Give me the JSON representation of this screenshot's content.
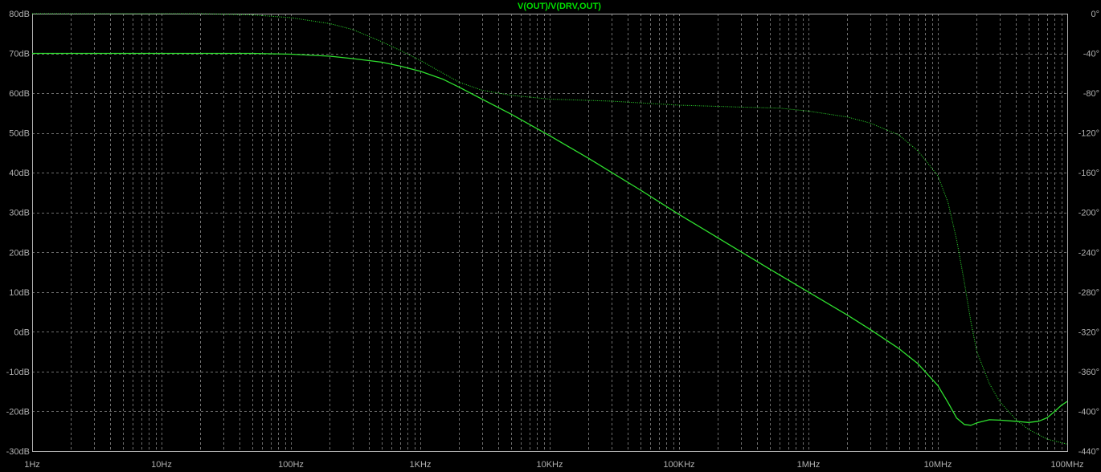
{
  "colors": {
    "background": "#000000",
    "frame": "#b0b0b0",
    "grid": "#6e6e6e",
    "trace": "#2fe02f",
    "title": "#00e000",
    "ticks": "#b0b0b0"
  },
  "chart_data": {
    "type": "line",
    "title": "V(OUT)/V(DRV,OUT)",
    "x_scale": "log",
    "xlim": [
      1,
      100000000
    ],
    "x_ticks": [
      {
        "value": 1,
        "label": "1Hz"
      },
      {
        "value": 10,
        "label": "10Hz"
      },
      {
        "value": 100,
        "label": "100Hz"
      },
      {
        "value": 1000,
        "label": "1KHz"
      },
      {
        "value": 10000,
        "label": "10KHz"
      },
      {
        "value": 100000,
        "label": "100KHz"
      },
      {
        "value": 1000000,
        "label": "1MHz"
      },
      {
        "value": 10000000,
        "label": "10MHz"
      },
      {
        "value": 100000000,
        "label": "100MHz"
      }
    ],
    "ylim_left": [
      -30,
      80
    ],
    "y_left_ticks": [
      {
        "value": 80,
        "label": "80dB"
      },
      {
        "value": 70,
        "label": "70dB"
      },
      {
        "value": 60,
        "label": "60dB"
      },
      {
        "value": 50,
        "label": "50dB"
      },
      {
        "value": 40,
        "label": "40dB"
      },
      {
        "value": 30,
        "label": "30dB"
      },
      {
        "value": 20,
        "label": "20dB"
      },
      {
        "value": 10,
        "label": "10dB"
      },
      {
        "value": 0,
        "label": "0dB"
      },
      {
        "value": -10,
        "label": "-10dB"
      },
      {
        "value": -20,
        "label": "-20dB"
      },
      {
        "value": -30,
        "label": "-30dB"
      }
    ],
    "ylim_right": [
      -440,
      0
    ],
    "y_right_ticks": [
      {
        "value": 0,
        "label": "0°"
      },
      {
        "value": -40,
        "label": "-40°"
      },
      {
        "value": -80,
        "label": "-80°"
      },
      {
        "value": -120,
        "label": "-120°"
      },
      {
        "value": -160,
        "label": "-160°"
      },
      {
        "value": -200,
        "label": "-200°"
      },
      {
        "value": -240,
        "label": "-240°"
      },
      {
        "value": -280,
        "label": "-280°"
      },
      {
        "value": -320,
        "label": "-320°"
      },
      {
        "value": -360,
        "label": "-360°"
      },
      {
        "value": -400,
        "label": "-400°"
      },
      {
        "value": -440,
        "label": "-440°"
      }
    ],
    "grid": true,
    "series": [
      {
        "axis": "left",
        "style": "solid",
        "points": [
          [
            1,
            70
          ],
          [
            10,
            70
          ],
          [
            50,
            70
          ],
          [
            100,
            69.8
          ],
          [
            200,
            69.3
          ],
          [
            300,
            68.7
          ],
          [
            500,
            67.8
          ],
          [
            700,
            66.8
          ],
          [
            1000,
            65.5
          ],
          [
            1500,
            63.5
          ],
          [
            2000,
            61.5
          ],
          [
            3000,
            58.5
          ],
          [
            5000,
            54.8
          ],
          [
            10000,
            49.3
          ],
          [
            20000,
            43.6
          ],
          [
            50000,
            35.7
          ],
          [
            100000,
            29.5
          ],
          [
            200000,
            23.6
          ],
          [
            500000,
            15.8
          ],
          [
            1000000,
            10
          ],
          [
            2000000,
            4.2
          ],
          [
            3000000,
            0.6
          ],
          [
            5000000,
            -4.2
          ],
          [
            7000000,
            -8
          ],
          [
            10000000,
            -13.5
          ],
          [
            12000000,
            -17.8
          ],
          [
            14000000,
            -21.7
          ],
          [
            16000000,
            -23.3
          ],
          [
            18000000,
            -23.5
          ],
          [
            20000000,
            -22.9
          ],
          [
            25000000,
            -22.1
          ],
          [
            30000000,
            -22.2
          ],
          [
            40000000,
            -22.5
          ],
          [
            50000000,
            -22.8
          ],
          [
            60000000,
            -22.5
          ],
          [
            70000000,
            -21.6
          ],
          [
            80000000,
            -20
          ],
          [
            90000000,
            -18.5
          ],
          [
            100000000,
            -17.5
          ]
        ]
      },
      {
        "axis": "right",
        "style": "dotted",
        "points": [
          [
            1,
            0
          ],
          [
            10,
            0
          ],
          [
            20,
            0
          ],
          [
            50,
            -1.2
          ],
          [
            100,
            -4
          ],
          [
            200,
            -10
          ],
          [
            300,
            -16
          ],
          [
            500,
            -28
          ],
          [
            700,
            -37
          ],
          [
            1000,
            -47
          ],
          [
            1500,
            -60
          ],
          [
            2000,
            -69
          ],
          [
            3000,
            -77
          ],
          [
            5000,
            -82
          ],
          [
            10000,
            -86
          ],
          [
            30000,
            -88
          ],
          [
            100000,
            -92
          ],
          [
            300000,
            -94
          ],
          [
            600000,
            -95
          ],
          [
            1000000,
            -98
          ],
          [
            2000000,
            -104
          ],
          [
            3000000,
            -110
          ],
          [
            5000000,
            -122
          ],
          [
            7000000,
            -138
          ],
          [
            10000000,
            -163
          ],
          [
            12000000,
            -190
          ],
          [
            14000000,
            -228
          ],
          [
            16000000,
            -270
          ],
          [
            18000000,
            -310
          ],
          [
            20000000,
            -340
          ],
          [
            25000000,
            -372
          ],
          [
            30000000,
            -390
          ],
          [
            40000000,
            -408
          ],
          [
            50000000,
            -418
          ],
          [
            70000000,
            -428
          ],
          [
            100000000,
            -433
          ]
        ]
      }
    ]
  }
}
